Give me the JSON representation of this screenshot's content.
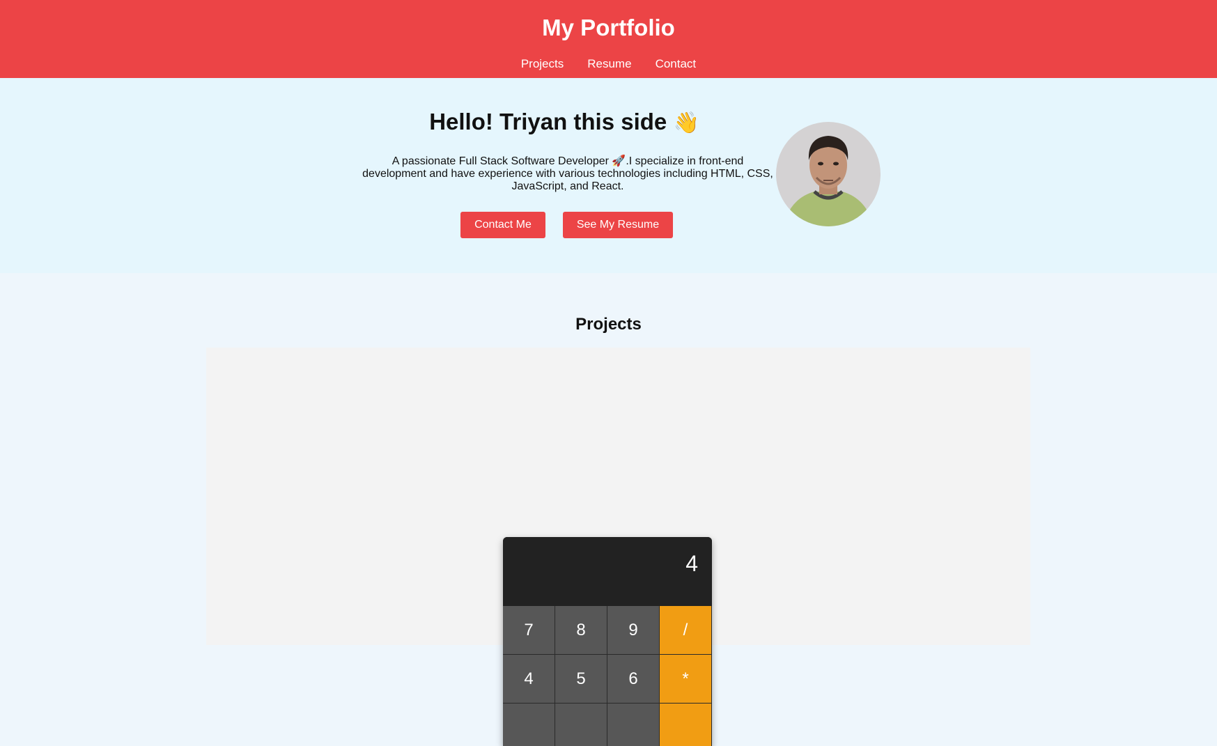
{
  "header": {
    "title": "My Portfolio",
    "nav": [
      "Projects",
      "Resume",
      "Contact"
    ]
  },
  "hero": {
    "greeting": "Hello! Triyan this side",
    "wave": "👋",
    "description": "A passionate Full Stack Software Developer 🚀.I specialize in front-end development and have experience with various technologies including HTML, CSS, JavaScript, and React.",
    "buttons": [
      "Contact Me",
      "See My Resume"
    ]
  },
  "projects": {
    "title": "Projects",
    "calculator": {
      "display": "4",
      "keys": [
        "7",
        "8",
        "9",
        "/",
        "4",
        "5",
        "6",
        "*",
        "",
        "",
        "",
        ""
      ]
    }
  },
  "colors": {
    "accent": "#ec4446",
    "operator": "#f19d13"
  }
}
